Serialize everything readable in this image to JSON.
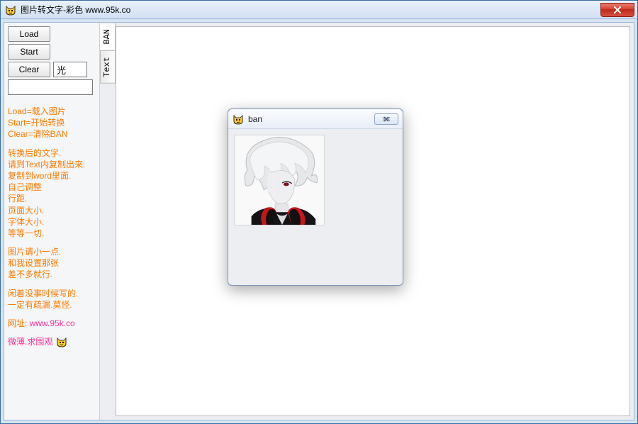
{
  "window": {
    "title": "图片转文字-彩色     www.95k.co"
  },
  "sidebar": {
    "buttons": {
      "load": "Load",
      "start": "Start",
      "clear": "Clear"
    },
    "char_input_value": "光",
    "blank_input_value": ""
  },
  "tabs": {
    "ban": "BAN",
    "text": "Text"
  },
  "help": {
    "p1": "Load=载入图片\nStart=开始转换\nClear=清除BAN",
    "p2": "转换后的文字.\n请到Text内复制出来.\n复制到word里面.\n自己调整\n行距.\n页面大小.\n字体大小.\n等等一切.",
    "p3": "图片请小一点.\n和我设置那张\n差不多就行.",
    "p4": "闲着没事时候写的.\n一定有疏漏.莫怪.",
    "p5_prefix": "网址: ",
    "p5_link": "www.95k.co",
    "p6": "微薄.求围观"
  },
  "dialog": {
    "title": "ban"
  }
}
